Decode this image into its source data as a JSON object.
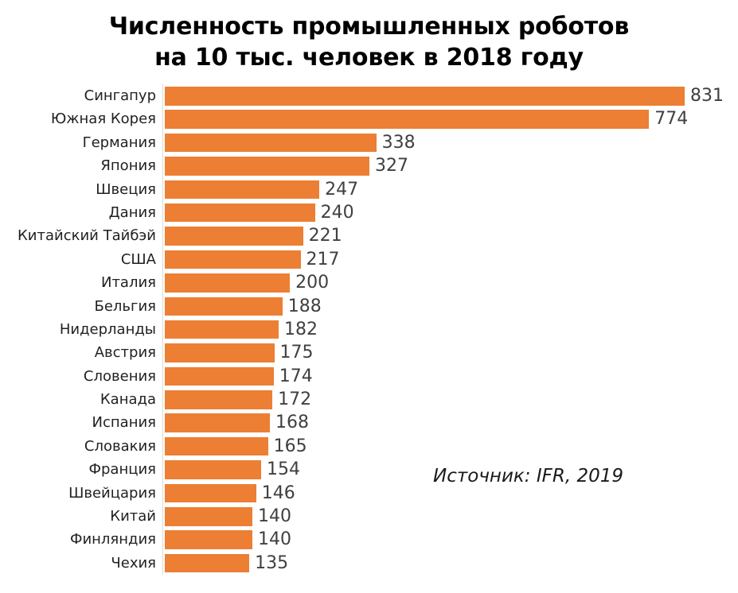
{
  "chart_data": {
    "type": "bar",
    "orientation": "horizontal",
    "title": "Численность промышленных роботов на 10 тыс. человек в 2018 году",
    "title_lines": [
      "Численность промышленных роботов",
      "на 10 тыс. человек в 2018 году"
    ],
    "xlabel": "",
    "ylabel": "",
    "xlim": [
      0,
      831
    ],
    "grid": false,
    "legend": null,
    "value_labels": true,
    "bar_color": "#ec7f34",
    "label_color": "#231f20",
    "value_color": "#404040",
    "annotation": "Источник: IFR, 2019",
    "categories": [
      "Сингапур",
      "Южная Корея",
      "Германия",
      "Япония",
      "Швеция",
      "Дания",
      "Китайский Тайбэй",
      "США",
      "Италия",
      "Бельгия",
      "Нидерланды",
      "Австрия",
      "Словения",
      "Канада",
      "Испания",
      "Словакия",
      "Франция",
      "Швейцария",
      "Китай",
      "Финляндия",
      "Чехия"
    ],
    "values": [
      831,
      774,
      338,
      327,
      247,
      240,
      221,
      217,
      200,
      188,
      182,
      175,
      174,
      172,
      168,
      165,
      154,
      146,
      140,
      140,
      135
    ]
  }
}
